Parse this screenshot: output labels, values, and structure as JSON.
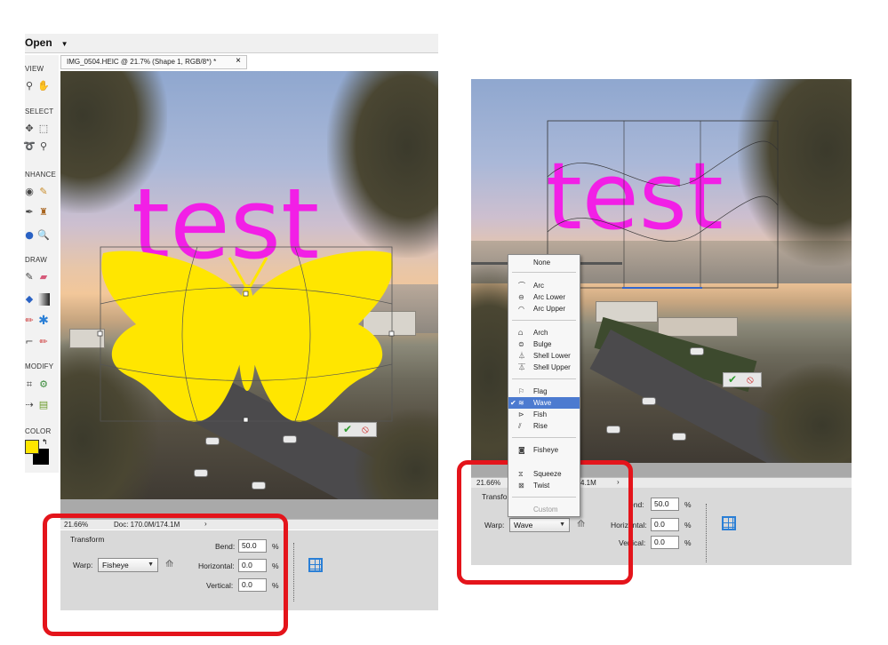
{
  "left_editor": {
    "menu_open": "Open",
    "doc_tab_title": "IMG_0504.HEIC @ 21.7% (Shape 1, RGB/8*) *",
    "tab_close": "×",
    "tool_sections": [
      "VIEW",
      "SELECT",
      "NHANCE",
      "DRAW",
      "MODIFY",
      "COLOR"
    ],
    "canvas_text": "test",
    "status_zoom": "21.66%",
    "status_doc": "Doc: 170.0M/174.1M",
    "panel": {
      "title": "Transform",
      "warp_label": "Warp:",
      "warp_value": "Fisheye",
      "bend_label": "Bend:",
      "bend_value": "50.0",
      "horizontal_label": "Horizontal:",
      "horizontal_value": "0.0",
      "vertical_label": "Vertical:",
      "vertical_value": "0.0",
      "percent": "%"
    }
  },
  "right_editor": {
    "canvas_text": "test",
    "status_zoom": "21.66%",
    "status_doc": "4.1M",
    "panel": {
      "title": "Transfo",
      "warp_label": "Warp:",
      "warp_value": "Wave",
      "bend_label": "end:",
      "bend_value": "50.0",
      "horizontal_label": "Horizontal:",
      "horizontal_value": "0.0",
      "vertical_label": "Vertical:",
      "vertical_value": "0.0",
      "percent": "%"
    },
    "warp_menu": [
      {
        "label": "None",
        "icon": ""
      },
      {
        "label": "Arc",
        "icon": "arc-icon"
      },
      {
        "label": "Arc Lower",
        "icon": "arc-lower-icon"
      },
      {
        "label": "Arc Upper",
        "icon": "arc-upper-icon"
      },
      {
        "label": "Arch",
        "icon": "arch-icon"
      },
      {
        "label": "Bulge",
        "icon": "bulge-icon"
      },
      {
        "label": "Shell Lower",
        "icon": "shell-lower-icon"
      },
      {
        "label": "Shell Upper",
        "icon": "shell-upper-icon"
      },
      {
        "label": "Flag",
        "icon": "flag-icon"
      },
      {
        "label": "Wave",
        "icon": "wave-icon",
        "selected": true
      },
      {
        "label": "Fish",
        "icon": "fish-icon"
      },
      {
        "label": "Rise",
        "icon": "rise-icon"
      },
      {
        "label": "Fisheye",
        "icon": "fisheye-icon"
      },
      {
        "label": "Squeeze",
        "icon": "squeeze-icon"
      },
      {
        "label": "Twist",
        "icon": "twist-icon"
      },
      {
        "label": "Custom",
        "icon": ""
      }
    ]
  },
  "colors": {
    "highlight_box": "#e4141b",
    "text_magenta": "#f21fe6",
    "butterfly_yellow": "#ffe600",
    "menu_selected": "#4c7bd0"
  }
}
